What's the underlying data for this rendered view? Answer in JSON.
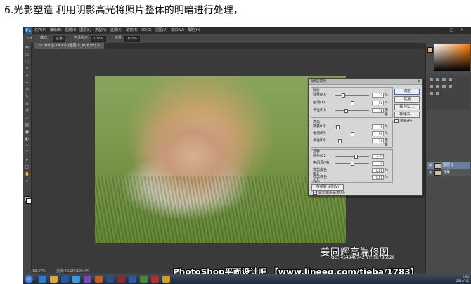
{
  "caption": "6.光影塑造 利用阴影高光将照片整体的明暗进行处理，",
  "photoshop": {
    "logo": "Ps",
    "menu": [
      "文件(F)",
      "编辑(E)",
      "图像(I)",
      "图层(L)",
      "类型(Y)",
      "选择(S)",
      "滤镜(T)",
      "3D(D)",
      "视图(V)",
      "窗口(W)",
      "帮助(H)"
    ],
    "options": {
      "mode_label": "模式:",
      "mode_value": "正常",
      "opacity_label": "不透明度:",
      "opacity_value": "100%",
      "flow_label": "流量:",
      "flow_value": "100%"
    },
    "document_tab": "25.psd @ 18.4% (图层 1, RGB/8*) ×",
    "status": {
      "zoom": "18.37%",
      "doc": "文档:43.2M/126.4M"
    }
  },
  "dialog": {
    "title": "阴影/高光",
    "shadows": {
      "label": "阴影",
      "rows": [
        {
          "name": "数量(A):",
          "value": "22",
          "unit": "%",
          "pos": 0.22
        },
        {
          "name": "色调(T):",
          "value": "50",
          "unit": "%",
          "pos": 0.5
        },
        {
          "name": "半径(R):",
          "value": "78",
          "unit": "像素",
          "pos": 0.31
        }
      ]
    },
    "highlights": {
      "label": "高光",
      "rows": [
        {
          "name": "数量(U):",
          "value": "6",
          "unit": "%",
          "pos": 0.06
        },
        {
          "name": "色调(N):",
          "value": "50",
          "unit": "%",
          "pos": 0.5
        },
        {
          "name": "半径(D):",
          "value": "30",
          "unit": "像素",
          "pos": 0.12
        }
      ]
    },
    "adjust": {
      "label": "调整",
      "rows": [
        {
          "name": "颜色(C):",
          "value": "+20",
          "unit": "",
          "pos": 0.6
        },
        {
          "name": "中间调(M):",
          "value": "0",
          "unit": "",
          "pos": 0.5
        },
        {
          "name": "修剪黑色(B):",
          "value": "0.01",
          "unit": "%",
          "pos": null
        },
        {
          "name": "修剪白色(W):",
          "value": "0.01",
          "unit": "%",
          "pos": null
        }
      ]
    },
    "buttons": [
      "确定",
      "取消",
      "载入(L)...",
      "存储(S)..."
    ],
    "preview_label": "预览(P)",
    "save_default_label": "存储默认值(V)",
    "more_options_label": "显示更多选项(O)"
  },
  "layers": [
    {
      "name": "图层 1",
      "selected": true
    },
    {
      "name": "背景",
      "selected": false
    }
  ],
  "signature": {
    "name": "姜同辉高端修图",
    "qq": "QQ: 454946742    YY: 98786628"
  },
  "banner": "PhotoShop平面设计吧  【www.lineeg.com/tieba/1783】",
  "clock": {
    "time": "0:24",
    "date": "2014/1/1"
  },
  "colors": {
    "accent": "#1f5c9c",
    "dialog_bg": "#d6d6d6",
    "ui_bg": "#3a3a3a"
  }
}
